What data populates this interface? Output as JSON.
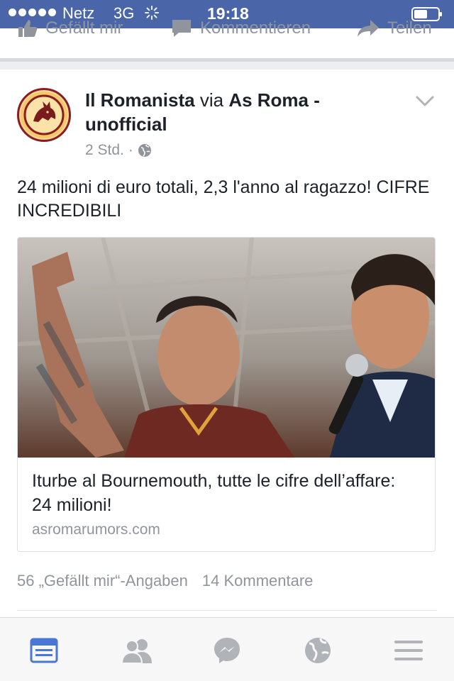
{
  "status_bar": {
    "carrier": "Netz",
    "network": "3G",
    "time": "19:18"
  },
  "previous_post_actions": {
    "like": "Gefällt mir",
    "comment": "Kommentieren",
    "share": "Teilen"
  },
  "post": {
    "author": "Il Romanista",
    "via": "via",
    "page": "As Roma - unofficial",
    "time": "2 Std.",
    "separator": "·",
    "privacy_icon": "globe-icon",
    "message": "24 milioni di euro totali, 2,3 l'anno al ragazzo! CIFRE INCREDIBILI",
    "link": {
      "title": "Iturbe al Bournemouth, tutte le cifre dell’affare: 24 milioni!",
      "domain": "asromarumors.com"
    },
    "likes": "56 „Gefällt mir“-Angaben",
    "comments": "14 Kommentare"
  },
  "tabbar": {
    "items": [
      "news-feed-icon",
      "friends-icon",
      "messenger-icon",
      "globe-notifications-icon",
      "menu-icon"
    ],
    "active_index": 0,
    "active_color": "#4a76d6",
    "inactive_color": "#b0b3b8"
  },
  "colors": {
    "status_bar": "#4a66a8",
    "secondary_text": "#90949c"
  }
}
